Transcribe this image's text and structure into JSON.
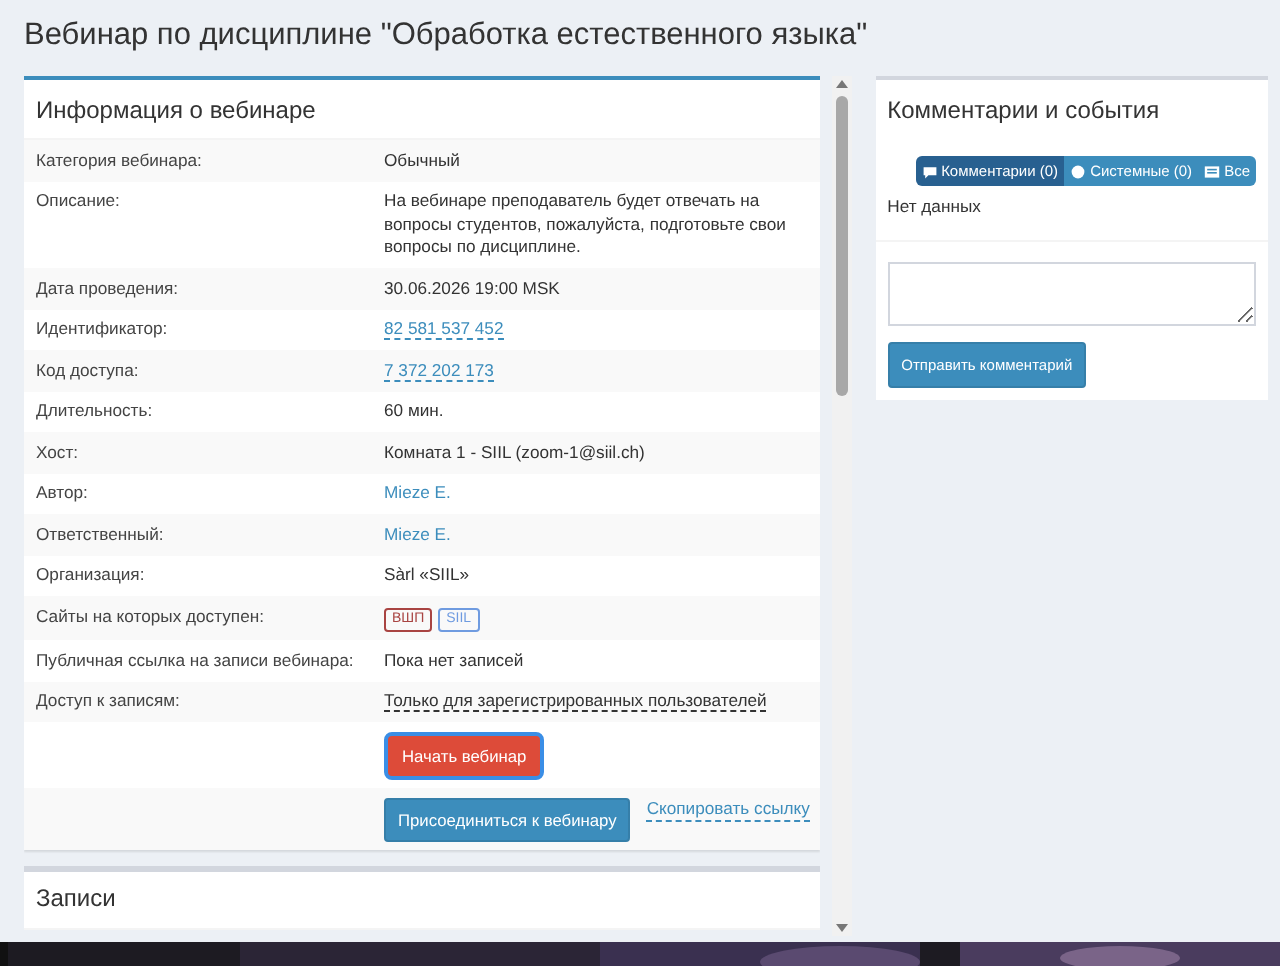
{
  "page_title": "Вебинар по дисциплине \"Обработка естественного языка\"",
  "info_panel": {
    "title": "Информация о вебинаре",
    "rows": [
      {
        "label": "Категория вебинара:",
        "kind": "text",
        "value": "Обычный"
      },
      {
        "label": "Описание:",
        "kind": "text",
        "value": "На вебинаре преподаватель будет отвечать на вопросы студентов, пожалуйста, подготовьте свои вопросы по дисциплине."
      },
      {
        "label": "Дата проведения:",
        "kind": "text",
        "value": "30.06.2026 19:00 MSK"
      },
      {
        "label": "Идентификатор:",
        "kind": "dotted-link",
        "value": "82 581 537 452"
      },
      {
        "label": "Код доступа:",
        "kind": "dotted-link",
        "value": "7 372 202 173"
      },
      {
        "label": "Длительность:",
        "kind": "text",
        "value": "60 мин."
      },
      {
        "label": "Хост:",
        "kind": "text",
        "value": "Комната 1 - SIIL (zoom-1@siil.ch)"
      },
      {
        "label": "Автор:",
        "kind": "link",
        "value": "Mieze E."
      },
      {
        "label": "Ответственный:",
        "kind": "link",
        "value": "Mieze E."
      },
      {
        "label": "Организация:",
        "kind": "text",
        "value": "Sàrl «SIIL»"
      },
      {
        "label": "Сайты на которых доступен:",
        "kind": "tags",
        "tags": [
          {
            "label": "ВШП",
            "color": "#a94442"
          },
          {
            "label": "SIIL",
            "color": "#6f9be0"
          }
        ]
      },
      {
        "label": "Публичная ссылка на записи вебинара:",
        "kind": "text",
        "value": "Пока нет записей"
      },
      {
        "label": "Доступ к записям:",
        "kind": "dotted-text",
        "value": "Только для зарегистрированных пользователей"
      }
    ],
    "start_button": "Начать вебинар",
    "join_button": "Присоединиться к вебинару",
    "copy_link": "Скопировать ссылку"
  },
  "records_panel": {
    "title": "Записи"
  },
  "comments_panel": {
    "title": "Комментарии и события",
    "filters": [
      {
        "label": "Комментарии (0)",
        "selected": true
      },
      {
        "label": "Системные (0)",
        "selected": false
      },
      {
        "label": "Все",
        "selected": false
      }
    ],
    "empty_text": "Нет данных",
    "submit_button": "Отправить комментарий"
  }
}
